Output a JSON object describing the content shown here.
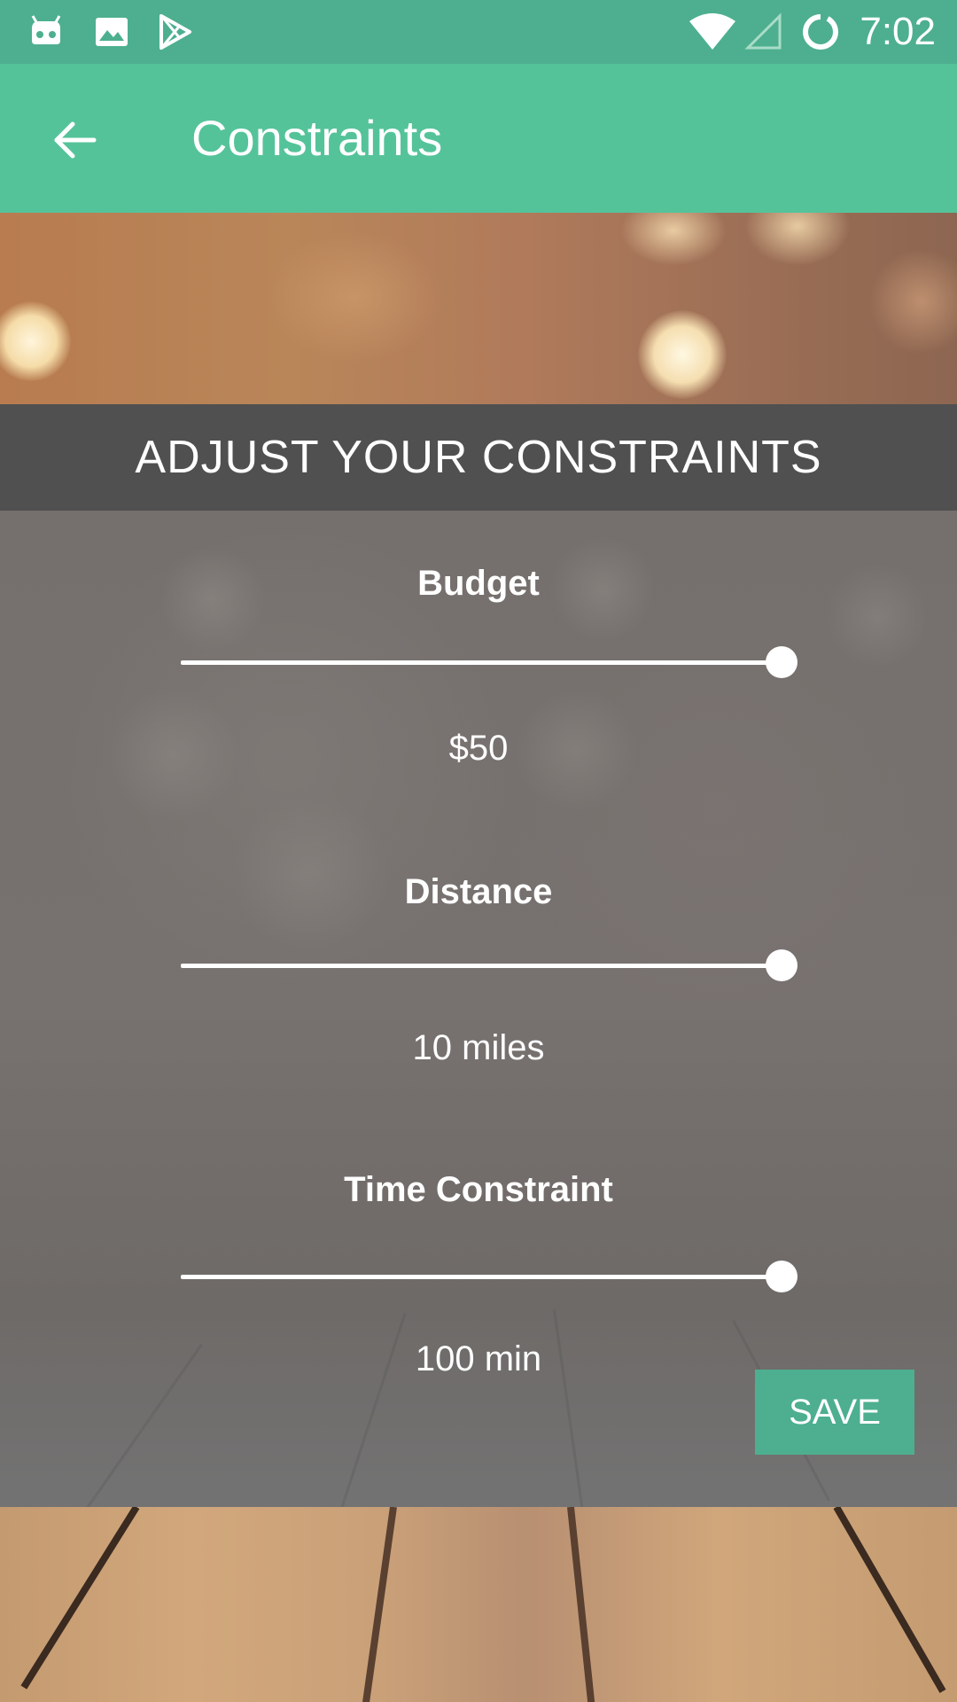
{
  "status_bar": {
    "time": "7:02",
    "icons": [
      "android-robot-icon",
      "image-icon",
      "play-store-icon",
      "wifi-icon",
      "cell-signal-icon",
      "sync-circle-icon"
    ]
  },
  "app_bar": {
    "title": "Constraints",
    "back_icon": "arrow-back-icon"
  },
  "header": {
    "title": "ADJUST YOUR CONSTRAINTS"
  },
  "constraints": [
    {
      "label": "Budget",
      "value_text": "$50",
      "slider_fraction": 1.0
    },
    {
      "label": "Distance",
      "value_text": "10 miles",
      "slider_fraction": 1.0
    },
    {
      "label": "Time Constraint",
      "value_text": "100 min",
      "slider_fraction": 1.0
    }
  ],
  "actions": {
    "save_label": "SAVE"
  },
  "colors": {
    "status_bar": "#4daf8f",
    "app_bar": "#55c39a",
    "header": "#505050",
    "accent": "#4daf8f"
  }
}
